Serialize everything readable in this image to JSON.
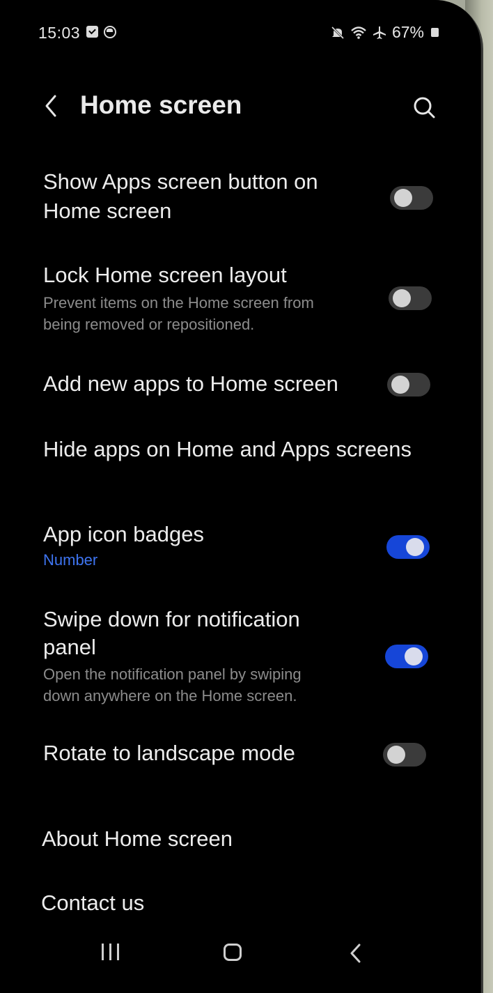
{
  "status_bar": {
    "time": "15:03",
    "battery": "67%",
    "icons": [
      "checkbox-notification-icon",
      "app-notification-icon",
      "mute-icon",
      "wifi-icon",
      "airplane-icon",
      "battery-icon"
    ]
  },
  "header": {
    "title": "Home screen",
    "back_icon": "chevron-left-icon",
    "search_icon": "search-icon"
  },
  "settings": [
    {
      "title_line1": "Show Apps screen button on",
      "title_line2": "Home screen",
      "toggle": false
    },
    {
      "title": "Lock Home screen layout",
      "desc_line1": "Prevent items on the Home screen from",
      "desc_line2": "being removed or repositioned.",
      "toggle": false
    },
    {
      "title": "Add new apps to Home screen",
      "toggle": false
    },
    {
      "title": "Hide apps on Home and Apps screens"
    },
    {
      "title": "App icon badges",
      "subtitle": "Number",
      "toggle": true
    },
    {
      "title_line1": "Swipe down for notification",
      "title_line2": "panel",
      "desc_line1": "Open the notification panel by swiping",
      "desc_line2": "down anywhere on the Home screen.",
      "toggle": true
    },
    {
      "title": "Rotate to landscape mode",
      "toggle": false
    }
  ],
  "links": {
    "about": "About Home screen",
    "contact": "Contact us"
  },
  "colors": {
    "accent": "#3e74f0",
    "toggle_on": "#1646d8",
    "toggle_off": "#3b3b3b",
    "background": "#000000"
  },
  "nav_bar": {
    "icons": [
      "recents-icon",
      "home-icon",
      "back-icon"
    ]
  }
}
